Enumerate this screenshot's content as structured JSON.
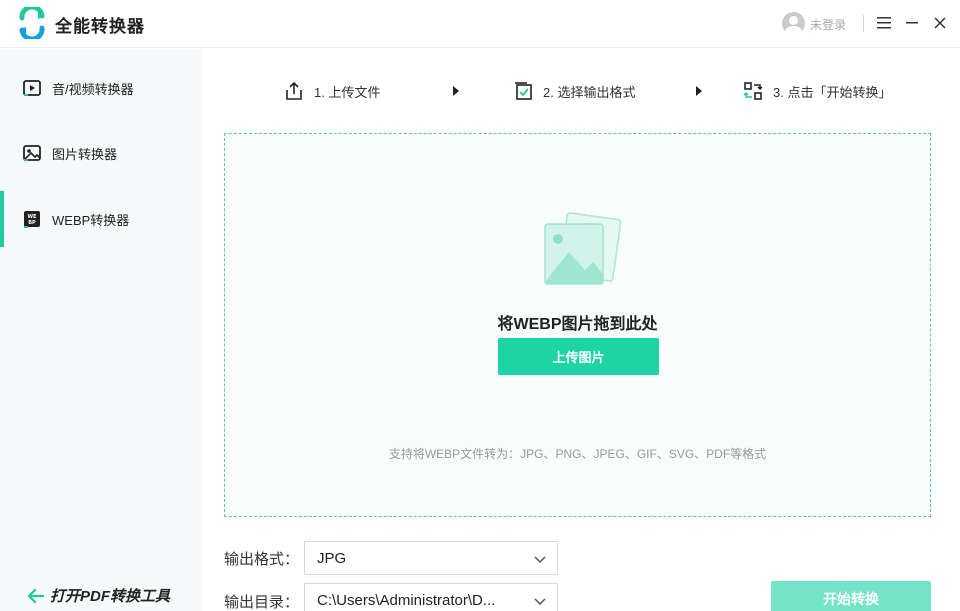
{
  "app": {
    "title": "全能转换器"
  },
  "header": {
    "login_text": "未登录"
  },
  "sidebar": {
    "items": [
      {
        "label": "音/视频转换器",
        "icon": "video-play-icon"
      },
      {
        "label": "图片转换器",
        "icon": "image-icon"
      },
      {
        "label": "WEBP转换器",
        "icon": "webp-icon"
      }
    ],
    "active_index": 2,
    "pdf_link_label": "打开PDF转换工具"
  },
  "steps": [
    {
      "label": "1. 上传文件",
      "icon": "upload-icon"
    },
    {
      "label": "2. 选择输出格式",
      "icon": "checklist-icon"
    },
    {
      "label": "3. 点击「开始转换」",
      "icon": "convert-icon"
    }
  ],
  "dropzone": {
    "title": "将WEBP图片拖到此处",
    "upload_button": "上传图片",
    "support_text": "支持将WEBP文件转为：JPG、PNG、JPEG、GIF、SVG、PDF等格式"
  },
  "form": {
    "format_label": "输出格式：",
    "format_value": "JPG",
    "dir_label": "输出目录：",
    "dir_value": "C:\\Users\\Administrator\\D..."
  },
  "start_button": "开始转换",
  "colors": {
    "accent": "#22c7a4",
    "button": "#1fd4a4",
    "button_disabled": "#74e4c9"
  }
}
